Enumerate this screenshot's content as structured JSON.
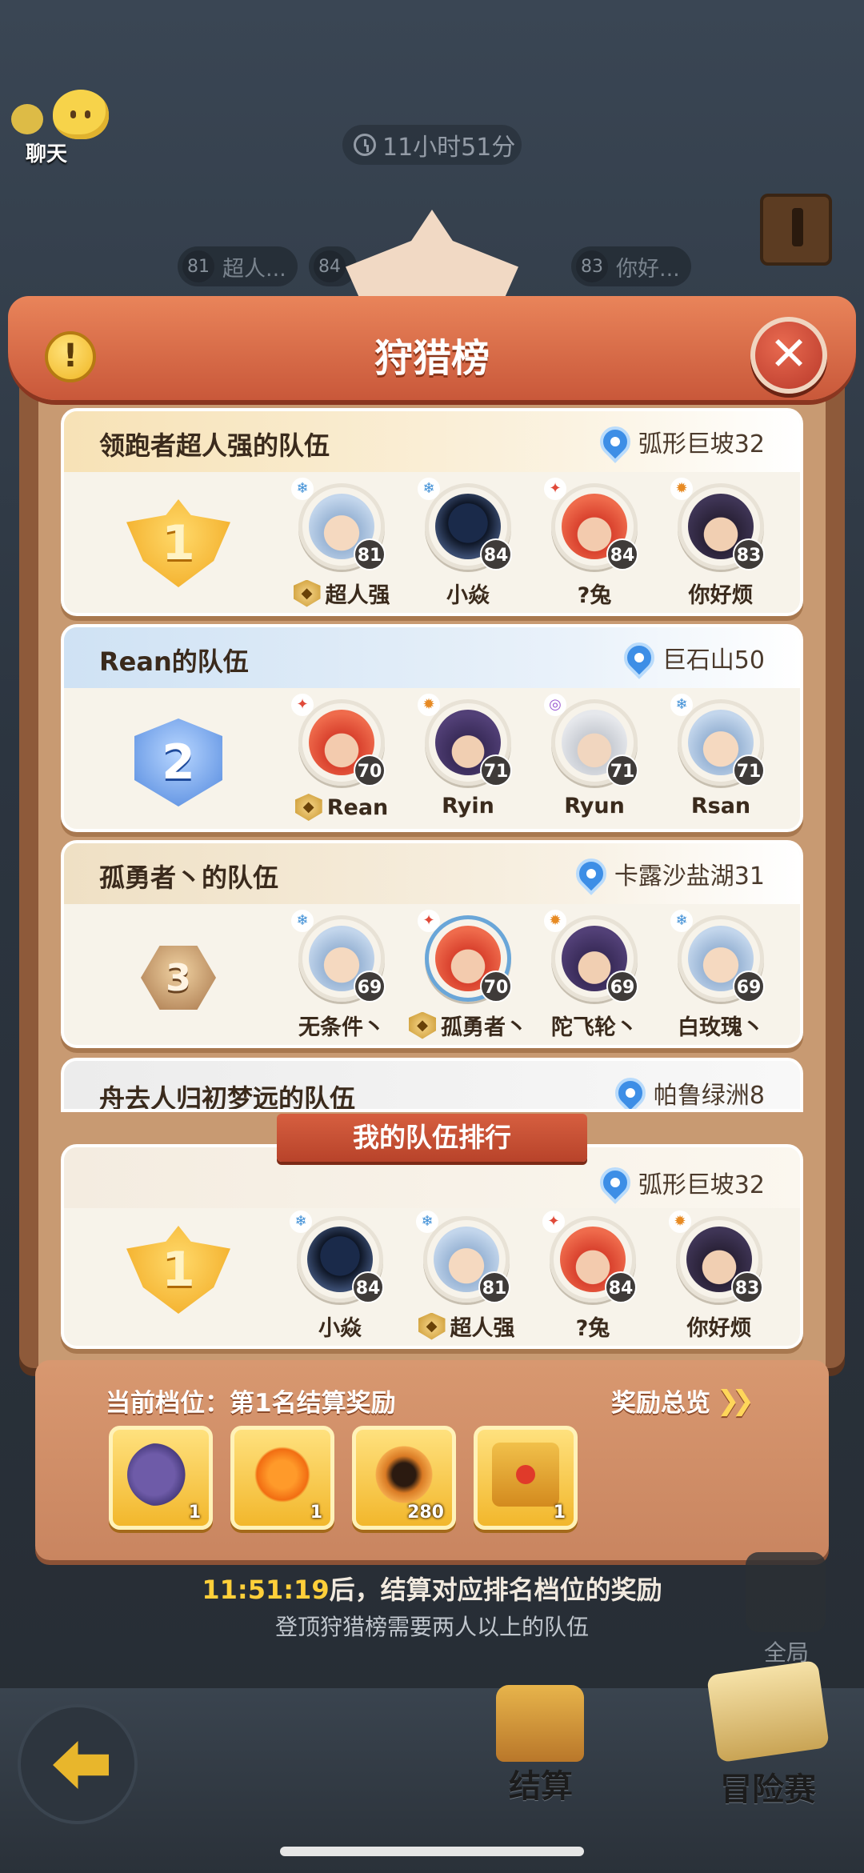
{
  "hud": {
    "chat_label": "聊天",
    "timer": "11小时51分",
    "bg_ranks": [
      {
        "level": "81",
        "name": "超人..."
      },
      {
        "level": "84",
        "name": ""
      },
      {
        "level": "83",
        "name": "你好..."
      }
    ]
  },
  "panel": {
    "title": "狩猎榜",
    "info_glyph": "!",
    "close_glyph": "✕"
  },
  "teams": [
    {
      "name": "领跑者超人强的队伍",
      "location": "弧形巨坡32",
      "rank": "1",
      "members": [
        {
          "name": "超人强",
          "level": "81",
          "captain": true,
          "element": "ice-icon"
        },
        {
          "name": "小焱",
          "level": "84",
          "captain": false,
          "element": "ice-icon"
        },
        {
          "name": "?兔",
          "level": "84",
          "captain": false,
          "element": "fire-icon"
        },
        {
          "name": "你好烦",
          "level": "83",
          "captain": false,
          "element": "sun-icon"
        }
      ]
    },
    {
      "name": "Rean的队伍",
      "location": "巨石山50",
      "rank": "2",
      "members": [
        {
          "name": "Rean",
          "level": "70",
          "captain": true,
          "element": "fire-icon"
        },
        {
          "name": "Ryin",
          "level": "71",
          "captain": false,
          "element": "sun-icon"
        },
        {
          "name": "Ryun",
          "level": "71",
          "captain": false,
          "element": "wind-icon"
        },
        {
          "name": "Rsan",
          "level": "71",
          "captain": false,
          "element": "ice-icon"
        }
      ]
    },
    {
      "name": "孤勇者丶的队伍",
      "location": "卡露沙盐湖31",
      "rank": "3",
      "members": [
        {
          "name": "无条件丶",
          "level": "69",
          "captain": false,
          "element": "ice-icon"
        },
        {
          "name": "孤勇者丶",
          "level": "70",
          "captain": true,
          "element": "fire-icon"
        },
        {
          "name": "陀飞轮丶",
          "level": "69",
          "captain": false,
          "element": "sun-icon"
        },
        {
          "name": "白玫瑰丶",
          "level": "69",
          "captain": false,
          "element": "ice-icon"
        }
      ]
    },
    {
      "name": "舟去人归初梦远的队伍",
      "location": "帕鲁绿洲8"
    }
  ],
  "my_team": {
    "banner": "我的队伍排行",
    "location": "弧形巨坡32",
    "rank": "1",
    "members": [
      {
        "name": "小焱",
        "level": "84",
        "captain": false,
        "element": "ice-icon"
      },
      {
        "name": "超人强",
        "level": "81",
        "captain": true,
        "element": "ice-icon"
      },
      {
        "name": "?兔",
        "level": "84",
        "captain": false,
        "element": "fire-icon"
      },
      {
        "name": "你好烦",
        "level": "83",
        "captain": false,
        "element": "sun-icon"
      }
    ]
  },
  "rewards": {
    "tier_label": "当前档位：第1名结算奖励",
    "overview_label": "奖励总览",
    "items": [
      {
        "icon": "cloud-item-icon",
        "count": "1"
      },
      {
        "icon": "flame-item-icon",
        "count": "1"
      },
      {
        "icon": "orb-item-icon",
        "count": "280"
      },
      {
        "icon": "chest-item-icon",
        "count": "1"
      }
    ]
  },
  "footer": {
    "countdown": "11:51:19",
    "settle_text": "后，结算对应排名档位的奖励",
    "need_text": "登顶狩猎榜需要两人以上的队伍",
    "global_label": "全局",
    "settle_label": "结算",
    "adventure_label": "冒险赛"
  },
  "colors": {
    "banner": "#d65f40",
    "gold": "#f0b623",
    "countdown": "#ffcf3a",
    "pin": "#3d8ee6"
  }
}
